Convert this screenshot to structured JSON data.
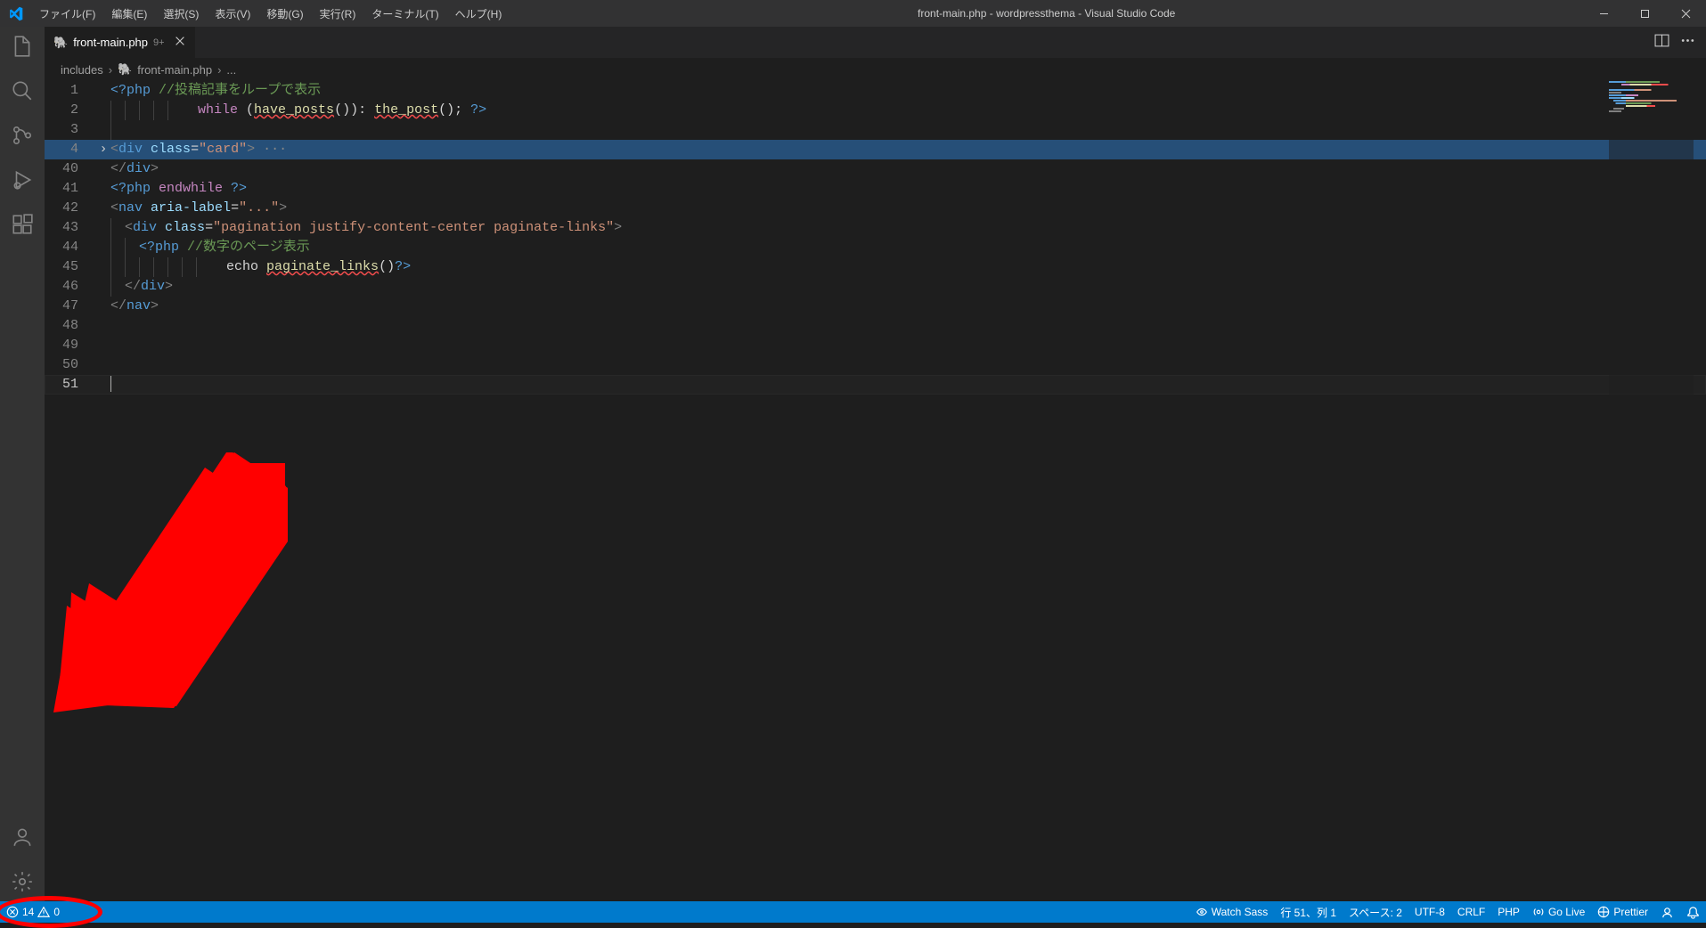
{
  "titlebar": {
    "menu": [
      "ファイル(F)",
      "編集(E)",
      "選択(S)",
      "表示(V)",
      "移動(G)",
      "実行(R)",
      "ターミナル(T)",
      "ヘルプ(H)"
    ],
    "title": "front-main.php - wordpressthema - Visual Studio Code"
  },
  "tab": {
    "name": "front-main.php",
    "dirty_badge": "9+"
  },
  "breadcrumb": {
    "seg1": "includes",
    "seg2": "front-main.php",
    "seg3": "..."
  },
  "code": {
    "lines": [
      "1",
      "2",
      "3",
      "4",
      "40",
      "41",
      "42",
      "43",
      "44",
      "45",
      "46",
      "47",
      "48",
      "49",
      "50",
      "51"
    ],
    "l1_php": "<?php ",
    "l1_cmt": "//投稿記事をループで表示",
    "l2_kw": "while",
    "l2_p1": " (",
    "l2_f1": "have_posts",
    "l2_p2": "()): ",
    "l2_f2": "the_post",
    "l2_p3": "(); ",
    "l2_close": "?>",
    "l4_t1": "<",
    "l4_name": "div",
    "l4_sp": " ",
    "l4_attr": "class",
    "l4_eq": "=",
    "l4_str": "\"card\"",
    "l4_t2": ">",
    "l4_dots": " ···",
    "l40_t1": "</",
    "l40_name": "div",
    "l40_t2": ">",
    "l41_php": "<?php ",
    "l41_kw": "endwhile",
    "l41_close": " ?>",
    "l42_t1": "<",
    "l42_name": "nav",
    "l42_sp": " ",
    "l42_attr": "aria-label",
    "l42_eq": "=",
    "l42_str": "\"...\"",
    "l42_t2": ">",
    "l43_t1": "<",
    "l43_name": "div",
    "l43_sp": " ",
    "l43_attr": "class",
    "l43_eq": "=",
    "l43_str": "\"pagination justify-content-center paginate-links\"",
    "l43_t2": ">",
    "l44_php": "<?php ",
    "l44_cmt": "//数字のページ表示",
    "l45_echo": "echo ",
    "l45_func": "paginate_links",
    "l45_p": "()",
    "l45_close": "?>",
    "l46_t1": "</",
    "l46_name": "div",
    "l46_t2": ">",
    "l47_t1": "</",
    "l47_name": "nav",
    "l47_t2": ">"
  },
  "status": {
    "errors": "14",
    "warnings": "0",
    "watch": "Watch Sass",
    "pos": "行 51、列 1",
    "spaces": "スペース: 2",
    "encoding": "UTF-8",
    "eol": "CRLF",
    "lang": "PHP",
    "golive": "Go Live",
    "prettier": "Prettier"
  }
}
